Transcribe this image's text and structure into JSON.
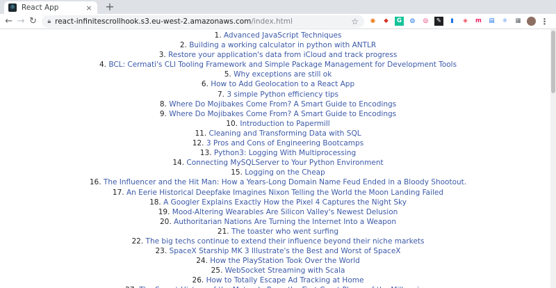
{
  "browser": {
    "tab": {
      "title": "React App",
      "close_glyph": "×",
      "favicon": "react-icon"
    },
    "new_tab_glyph": "+",
    "nav": {
      "back_glyph": "←",
      "forward_glyph": "→",
      "reload_glyph": "↻"
    },
    "address": {
      "host": "react-infinitescrollhook.s3.eu-west-2.amazonaws.com",
      "path": "/index.html"
    },
    "extensions": [
      {
        "name": "firefox-like-icon",
        "glyph": "◉",
        "color": "#e8710a",
        "bg": "#ffffff"
      },
      {
        "name": "shield-icon",
        "glyph": "◆",
        "color": "#d93025",
        "bg": "#ffffff"
      },
      {
        "name": "grammarly-icon",
        "glyph": "G",
        "color": "#ffffff",
        "bg": "#15c39a"
      },
      {
        "name": "globe-icon",
        "glyph": "◍",
        "color": "#1a73e8",
        "bg": "#ffffff"
      },
      {
        "name": "target-icon",
        "glyph": "◎",
        "color": "#e91e63",
        "bg": "#ffffff"
      },
      {
        "name": "edit-icon",
        "glyph": "✎",
        "color": "#ffffff",
        "bg": "#202124"
      },
      {
        "name": "bookmark-icon",
        "glyph": "▮",
        "color": "#1a73e8",
        "bg": "#ffffff"
      },
      {
        "name": "pocket-icon",
        "glyph": "◈",
        "color": "#ef4056",
        "bg": "#ffffff"
      },
      {
        "name": "medium-icon",
        "glyph": "m",
        "color": "#e91e63",
        "bg": "#ffffff"
      },
      {
        "name": "docs-icon",
        "glyph": "▤",
        "color": "#1a73e8",
        "bg": "#ffffff"
      },
      {
        "name": "atom-icon",
        "glyph": "⚛",
        "color": "#1a73e8",
        "bg": "#ffffff"
      },
      {
        "name": "grid-icon",
        "glyph": "▦",
        "color": "#5f6368",
        "bg": "#ffffff"
      }
    ],
    "menu_glyph": "⋮"
  },
  "articles": [
    {
      "num": "1.",
      "title": "Advanced JavaScript Techniques"
    },
    {
      "num": "2.",
      "title": "Building a working calculator in python with ANTLR"
    },
    {
      "num": "3.",
      "title": "Restore your application's data from iCloud and track progress"
    },
    {
      "num": "4.",
      "title": "BCL: Cermati's CLI Tooling Framework and Simple Package Management for Development Tools"
    },
    {
      "num": "5.",
      "title": "Why exceptions are still ok"
    },
    {
      "num": "6.",
      "title": "How to Add Geolocation to a React App"
    },
    {
      "num": "7.",
      "title": "3 simple Python efficiency tips"
    },
    {
      "num": "8.",
      "title": "Where Do Mojibakes Come From? A Smart Guide to Encodings"
    },
    {
      "num": "9.",
      "title": "Where Do Mojibakes Come From? A Smart Guide to Encodings"
    },
    {
      "num": "10.",
      "title": "Introduction to Papermill"
    },
    {
      "num": "11.",
      "title": "Cleaning and Transforming Data with SQL"
    },
    {
      "num": "12.",
      "title": "3 Pros and Cons of Engineering Bootcamps"
    },
    {
      "num": "13.",
      "title": "Python3: Logging With Multiprocessing"
    },
    {
      "num": "14.",
      "title": "Connecting MySQLServer to Your Python Environment"
    },
    {
      "num": "15.",
      "title": "Logging on the Cheap"
    },
    {
      "num": "16.",
      "title": "The Influencer and the Hit Man: How a Years-Long Domain Name Feud Ended in a Bloody Shootout."
    },
    {
      "num": "17.",
      "title": "An Eerie Historical Deepfake Imagines Nixon Telling the World the Moon Landing Failed"
    },
    {
      "num": "18.",
      "title": "A Googler Explains Exactly How the Pixel 4 Captures the Night Sky"
    },
    {
      "num": "19.",
      "title": "Mood-Altering Wearables Are Silicon Valley's Newest Delusion"
    },
    {
      "num": "20.",
      "title": "Authoritarian Nations Are Turning the Internet Into a Weapon"
    },
    {
      "num": "21.",
      "title": "The toaster who went surfing"
    },
    {
      "num": "22.",
      "title": "The big techs continue to extend their influence beyond their niche markets"
    },
    {
      "num": "23.",
      "title": "SpaceX Starship MK 3 Illustrate's the Best and Worst of SpaceX"
    },
    {
      "num": "24.",
      "title": "How the PlayStation Took Over the World"
    },
    {
      "num": "25.",
      "title": "WebSocket Streaming with Scala"
    },
    {
      "num": "26.",
      "title": "How to Totally Escape Ad Tracking at Home"
    },
    {
      "num": "27.",
      "title": "The Secret History of the Motorola Razr, the First Great Phone of the Millennium"
    }
  ]
}
